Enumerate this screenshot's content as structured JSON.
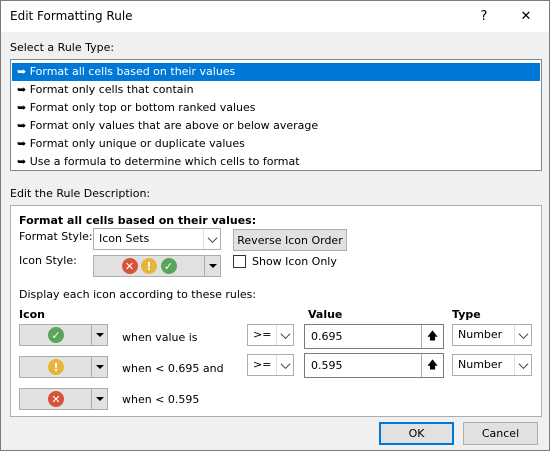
{
  "window": {
    "title": "Edit Formatting Rule",
    "help_label": "?",
    "close_label": "✕"
  },
  "rule_type": {
    "label": "Select a Rule Type:",
    "items": [
      {
        "label": "Format all cells based on their values",
        "selected": true
      },
      {
        "label": "Format only cells that contain",
        "selected": false
      },
      {
        "label": "Format only top or bottom ranked values",
        "selected": false
      },
      {
        "label": "Format only values that are above or below average",
        "selected": false
      },
      {
        "label": "Format only unique or duplicate values",
        "selected": false
      },
      {
        "label": "Use a formula to determine which cells to format",
        "selected": false
      }
    ]
  },
  "description": {
    "label": "Edit the Rule Description:",
    "heading": "Format all cells based on their values:",
    "format_style_label": "Format Style:",
    "format_style_value": "Icon Sets",
    "reverse_button": "Reverse Icon Order",
    "icon_style_label": "Icon Style:",
    "show_icon_only_label": "Show Icon Only",
    "show_icon_only_checked": false,
    "rules_caption": "Display each icon according to these rules:",
    "col_icon": "Icon",
    "col_value": "Value",
    "col_type": "Type",
    "rows": [
      {
        "icon": "green-check-icon",
        "condition": "when value is",
        "operator": ">=",
        "value": "0.695",
        "type": "Number"
      },
      {
        "icon": "yellow-exclamation-icon",
        "condition": "when < 0.695 and",
        "operator": ">=",
        "value": "0.595",
        "type": "Number"
      },
      {
        "icon": "red-x-icon",
        "condition": "when < 0.595"
      }
    ]
  },
  "buttons": {
    "ok": "OK",
    "cancel": "Cancel"
  },
  "colors": {
    "selection": "#0078d7",
    "icon_green": "#5aa55a",
    "icon_yellow": "#e8b53c",
    "icon_red": "#d9533c"
  }
}
